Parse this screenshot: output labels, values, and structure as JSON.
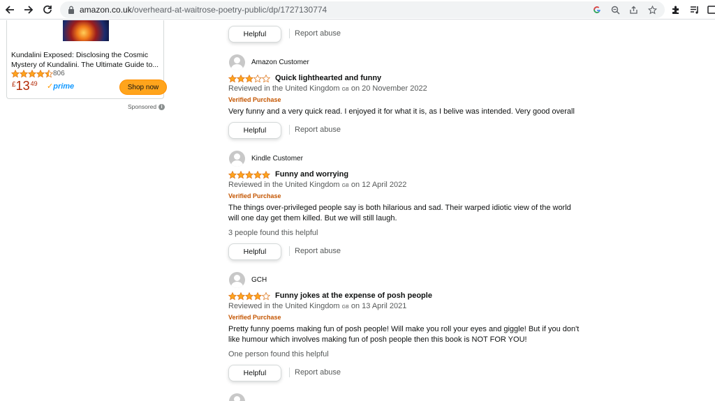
{
  "browser": {
    "url_domain": "amazon.co.uk",
    "url_path": "/overheard-at-waitrose-poetry-public/dp/1727130774"
  },
  "ad": {
    "title": "Kundalini Exposed: Disclosing the Cosmic Mystery of Kundalini. The Ultimate Guide to...",
    "rating": 4.5,
    "rating_count": "806",
    "price_currency": "£",
    "price_whole": "13",
    "price_fraction": "49",
    "prime_label": "prime",
    "shop_button": "Shop now",
    "sponsored_label": "Sponsored"
  },
  "top_actions": {
    "helpful_label": "Helpful",
    "report_label": "Report abuse"
  },
  "reviews": [
    {
      "reviewer": "Amazon Customer",
      "rating": 3,
      "title": "Quick lighthearted and funny",
      "meta_prefix": "Reviewed in the United Kingdom",
      "country_code": "GB",
      "meta_date": "on 20 November 2022",
      "verified": "Verified Purchase",
      "body": "Very funny and a very quick read. I enjoyed it for what it is, as I belive was intended. Very good overall",
      "helpful_count": "",
      "helpful_label": "Helpful",
      "report_label": "Report abuse"
    },
    {
      "reviewer": "Kindle Customer",
      "rating": 5,
      "title": "Funny and worrying",
      "meta_prefix": "Reviewed in the United Kingdom",
      "country_code": "GB",
      "meta_date": "on 12 April 2022",
      "verified": "Verified Purchase",
      "body": "The things over-privileged people say is both hilarious and sad. Their warped idiotic view of the world will one day get them killed. But we will still laugh.",
      "helpful_count": "3 people found this helpful",
      "helpful_label": "Helpful",
      "report_label": "Report abuse"
    },
    {
      "reviewer": "GCH",
      "rating": 4,
      "title": "Funny jokes at the expense of posh people",
      "meta_prefix": "Reviewed in the United Kingdom",
      "country_code": "GB",
      "meta_date": "on 13 April 2021",
      "verified": "Verified Purchase",
      "body": "Pretty funny poems making fun of posh people! Will make you roll your eyes and giggle! But if you don't like humour which involves making fun of posh people then this book is NOT FOR YOU!",
      "helpful_count": "One person found this helpful",
      "helpful_label": "Helpful",
      "report_label": "Report abuse"
    }
  ],
  "colors": {
    "star": "#ffa41c",
    "verified": "#c45500",
    "price": "#b12704",
    "shop_button": "#ffa41c"
  }
}
